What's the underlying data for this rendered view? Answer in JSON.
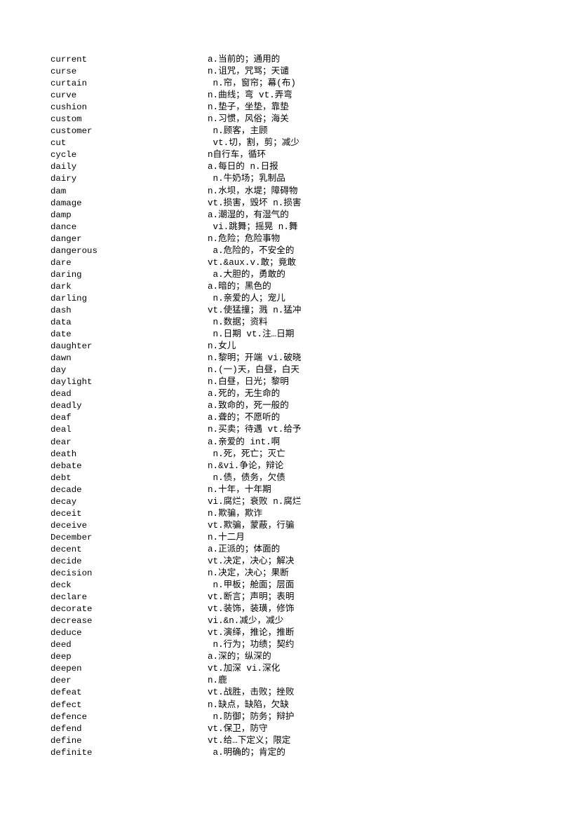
{
  "page": {
    "background_color": "#ffffff",
    "text_color": "#000000"
  },
  "word_list": {
    "entries": [
      {
        "term": "current",
        "definition": "a.当前的；通用的"
      },
      {
        "term": "curse",
        "definition": "n.诅咒，咒骂；天谴"
      },
      {
        "term": "curtain",
        "definition": " n.帘，窗帘；幕(布)"
      },
      {
        "term": "curve",
        "definition": "n.曲线；弯 vt.弄弯"
      },
      {
        "term": "cushion",
        "definition": "n.垫子，坐垫，靠垫"
      },
      {
        "term": "custom",
        "definition": "n.习惯，风俗；海关"
      },
      {
        "term": "customer",
        "definition": " n.顾客，主顾"
      },
      {
        "term": "cut",
        "definition": " vt.切，割，剪；减少"
      },
      {
        "term": "cycle",
        "definition": "n自行车，循环"
      },
      {
        "term": "daily",
        "definition": "a.每日的 n.日报"
      },
      {
        "term": "dairy",
        "definition": " n.牛奶场；乳制品"
      },
      {
        "term": "dam",
        "definition": "n.水坝，水堤；障碍物"
      },
      {
        "term": "damage",
        "definition": "vt.损害，毁坏 n.损害"
      },
      {
        "term": "damp",
        "definition": "a.潮湿的，有湿气的"
      },
      {
        "term": "dance",
        "definition": " vi.跳舞；摇晃 n.舞"
      },
      {
        "term": "danger",
        "definition": "n.危险；危险事物"
      },
      {
        "term": "dangerous",
        "definition": " a.危险的，不安全的"
      },
      {
        "term": "dare",
        "definition": "vt.&aux.v.敢；竟敢"
      },
      {
        "term": "daring",
        "definition": " a.大胆的，勇敢的"
      },
      {
        "term": "dark",
        "definition": "a.暗的；黑色的"
      },
      {
        "term": "darling",
        "definition": " n.亲爱的人；宠儿"
      },
      {
        "term": "dash",
        "definition": "vt.使猛撞；溅 n.猛冲"
      },
      {
        "term": "data",
        "definition": " n.数据；资料"
      },
      {
        "term": "date",
        "definition": " n.日期 vt.注…日期"
      },
      {
        "term": "daughter",
        "definition": "n.女儿"
      },
      {
        "term": "dawn",
        "definition": "n.黎明；开端 vi.破晓"
      },
      {
        "term": "day",
        "definition": "n.(一)天，白昼，白天"
      },
      {
        "term": "daylight",
        "definition": "n.白昼，日光；黎明"
      },
      {
        "term": "dead",
        "definition": "a.死的，无生命的"
      },
      {
        "term": "deadly",
        "definition": "a.致命的，死一般的"
      },
      {
        "term": "deaf",
        "definition": "a.聋的；不愿听的"
      },
      {
        "term": "deal",
        "definition": "n.买卖；待遇 vt.给予"
      },
      {
        "term": "dear",
        "definition": "a.亲爱的 int.啊"
      },
      {
        "term": "death",
        "definition": " n.死，死亡；灭亡"
      },
      {
        "term": "debate",
        "definition": "n.&vi.争论，辩论"
      },
      {
        "term": "debt",
        "definition": " n.债，债务，欠债"
      },
      {
        "term": "decade",
        "definition": "n.十年，十年期"
      },
      {
        "term": "decay",
        "definition": "vi.腐烂；衰败 n.腐烂"
      },
      {
        "term": "deceit",
        "definition": "n.欺骗，欺诈"
      },
      {
        "term": "deceive",
        "definition": "vt.欺骗，蒙蔽，行骗"
      },
      {
        "term": "December",
        "definition": "n.十二月"
      },
      {
        "term": "decent",
        "definition": "a.正派的；体面的"
      },
      {
        "term": "decide",
        "definition": "vt.决定，决心；解决"
      },
      {
        "term": "decision",
        "definition": "n.决定，决心；果断"
      },
      {
        "term": "deck",
        "definition": " n.甲板；舱面；层面"
      },
      {
        "term": "declare",
        "definition": "vt.断言；声明；表明"
      },
      {
        "term": "decorate",
        "definition": "vt.装饰，装璜，修饰"
      },
      {
        "term": "decrease",
        "definition": "vi.&n.减少，减少"
      },
      {
        "term": "deduce",
        "definition": "vt.演绎，推论，推断"
      },
      {
        "term": "deed",
        "definition": " n.行为；功绩；契约"
      },
      {
        "term": "deep",
        "definition": "a.深的；纵深的"
      },
      {
        "term": "deepen",
        "definition": "vt.加深 vi.深化"
      },
      {
        "term": "deer",
        "definition": "n.鹿"
      },
      {
        "term": "defeat",
        "definition": "vt.战胜，击败；挫败"
      },
      {
        "term": "defect",
        "definition": "n.缺点，缺陷，欠缺"
      },
      {
        "term": "defence",
        "definition": " n.防御；防务；辩护"
      },
      {
        "term": "defend",
        "definition": "vt.保卫，防守"
      },
      {
        "term": "define",
        "definition": "vt.给…下定义；限定"
      },
      {
        "term": "definite",
        "definition": " a.明确的；肯定的"
      }
    ]
  }
}
